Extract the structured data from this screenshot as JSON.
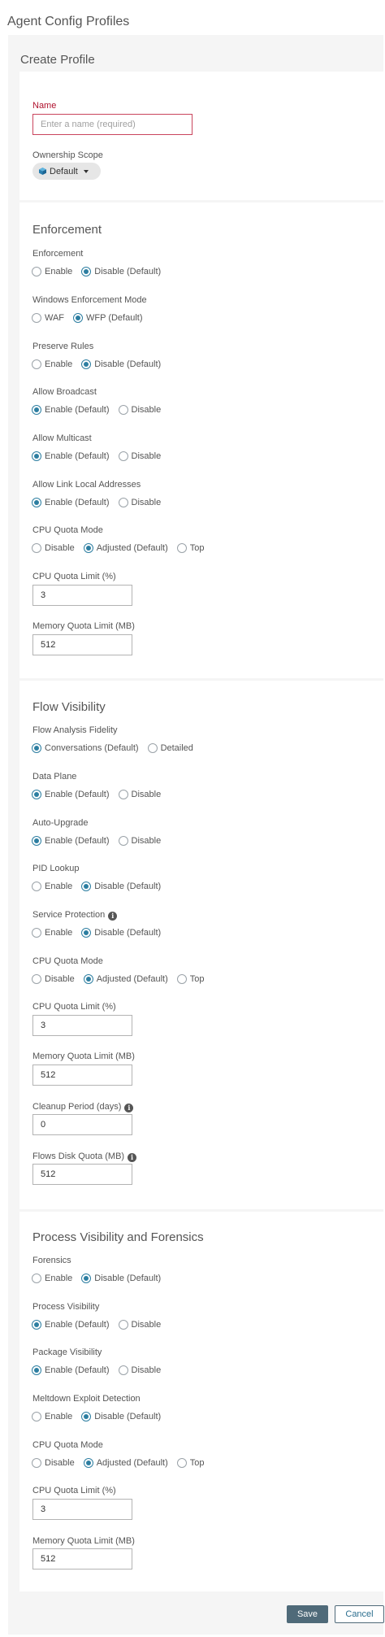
{
  "page": {
    "title": "Agent Config Profiles"
  },
  "card": {
    "title": "Create Profile"
  },
  "profile": {
    "name_label": "Name",
    "name_placeholder": "Enter a name (required)",
    "name_value": "",
    "scope_label": "Ownership Scope",
    "scope_value": "Default"
  },
  "enforcement": {
    "title": "Enforcement",
    "enforcement": {
      "label": "Enforcement",
      "options": [
        "Enable",
        "Disable (Default)"
      ],
      "selected": 1
    },
    "windows_mode": {
      "label": "Windows Enforcement Mode",
      "options": [
        "WAF",
        "WFP (Default)"
      ],
      "selected": 1
    },
    "preserve_rules": {
      "label": "Preserve Rules",
      "options": [
        "Enable",
        "Disable (Default)"
      ],
      "selected": 1
    },
    "allow_broadcast": {
      "label": "Allow Broadcast",
      "options": [
        "Enable (Default)",
        "Disable"
      ],
      "selected": 0
    },
    "allow_multicast": {
      "label": "Allow Multicast",
      "options": [
        "Enable (Default)",
        "Disable"
      ],
      "selected": 0
    },
    "allow_link_local": {
      "label": "Allow Link Local Addresses",
      "options": [
        "Enable (Default)",
        "Disable"
      ],
      "selected": 0
    },
    "cpu_quota_mode": {
      "label": "CPU Quota Mode",
      "options": [
        "Disable",
        "Adjusted (Default)",
        "Top"
      ],
      "selected": 1
    },
    "cpu_quota_limit": {
      "label": "CPU Quota Limit (%)",
      "value": "3"
    },
    "memory_quota_limit": {
      "label": "Memory Quota Limit (MB)",
      "value": "512"
    }
  },
  "flow_visibility": {
    "title": "Flow Visibility",
    "flow_analysis_fidelity": {
      "label": "Flow Analysis Fidelity",
      "options": [
        "Conversations (Default)",
        "Detailed"
      ],
      "selected": 0
    },
    "data_plane": {
      "label": "Data Plane",
      "options": [
        "Enable (Default)",
        "Disable"
      ],
      "selected": 0
    },
    "auto_upgrade": {
      "label": "Auto-Upgrade",
      "options": [
        "Enable (Default)",
        "Disable"
      ],
      "selected": 0
    },
    "pid_lookup": {
      "label": "PID Lookup",
      "options": [
        "Enable",
        "Disable (Default)"
      ],
      "selected": 1
    },
    "service_protection": {
      "label": "Service Protection",
      "options": [
        "Enable",
        "Disable (Default)"
      ],
      "selected": 1
    },
    "cpu_quota_mode": {
      "label": "CPU Quota Mode",
      "options": [
        "Disable",
        "Adjusted (Default)",
        "Top"
      ],
      "selected": 1
    },
    "cpu_quota_limit": {
      "label": "CPU Quota Limit (%)",
      "value": "3"
    },
    "memory_quota_limit": {
      "label": "Memory Quota Limit (MB)",
      "value": "512"
    },
    "cleanup_period": {
      "label": "Cleanup Period (days)",
      "value": "0"
    },
    "flows_disk_quota": {
      "label": "Flows Disk Quota (MB)",
      "value": "512"
    }
  },
  "process_visibility": {
    "title": "Process Visibility and Forensics",
    "forensics": {
      "label": "Forensics",
      "options": [
        "Enable",
        "Disable (Default)"
      ],
      "selected": 1
    },
    "process_visibility": {
      "label": "Process Visibility",
      "options": [
        "Enable (Default)",
        "Disable"
      ],
      "selected": 0
    },
    "package_visibility": {
      "label": "Package Visibility",
      "options": [
        "Enable (Default)",
        "Disable"
      ],
      "selected": 0
    },
    "meltdown_detection": {
      "label": "Meltdown Exploit Detection",
      "options": [
        "Enable",
        "Disable (Default)"
      ],
      "selected": 1
    },
    "cpu_quota_mode": {
      "label": "CPU Quota Mode",
      "options": [
        "Disable",
        "Adjusted (Default)",
        "Top"
      ],
      "selected": 1
    },
    "cpu_quota_limit": {
      "label": "CPU Quota Limit (%)",
      "value": "3"
    },
    "memory_quota_limit": {
      "label": "Memory Quota Limit (MB)",
      "value": "512"
    }
  },
  "buttons": {
    "save": "Save",
    "cancel": "Cancel"
  },
  "icons": {
    "scope": "cube-icon",
    "info": "info-icon"
  },
  "colors": {
    "accent": "#2d7ea1",
    "required": "#b0122e",
    "save_bg": "#4f6a79"
  }
}
